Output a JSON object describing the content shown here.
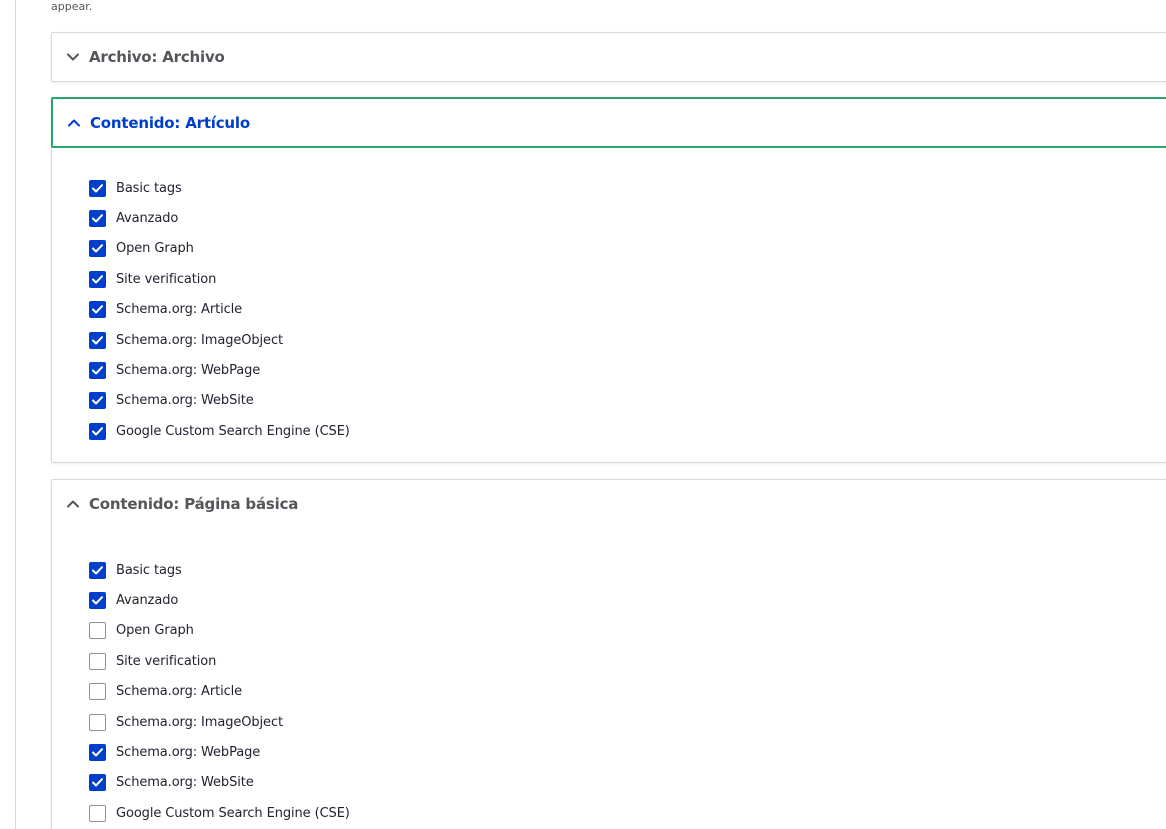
{
  "top_note": "appear.",
  "colors": {
    "accent": "#003ecc",
    "focus_border": "#26a769",
    "muted_text": "#55565b"
  },
  "panels": [
    {
      "title": "Archivo: Archivo",
      "expanded": false,
      "options": []
    },
    {
      "title": "Contenido: Artículo",
      "expanded": true,
      "focused": true,
      "options": [
        {
          "label": "Basic tags",
          "checked": true
        },
        {
          "label": "Avanzado",
          "checked": true
        },
        {
          "label": "Open Graph",
          "checked": true
        },
        {
          "label": "Site verification",
          "checked": true
        },
        {
          "label": "Schema.org: Article",
          "checked": true
        },
        {
          "label": "Schema.org: ImageObject",
          "checked": true
        },
        {
          "label": "Schema.org: WebPage",
          "checked": true
        },
        {
          "label": "Schema.org: WebSite",
          "checked": true
        },
        {
          "label": "Google Custom Search Engine (CSE)",
          "checked": true
        }
      ]
    },
    {
      "title": "Contenido: Página básica",
      "expanded": true,
      "options": [
        {
          "label": "Basic tags",
          "checked": true
        },
        {
          "label": "Avanzado",
          "checked": true
        },
        {
          "label": "Open Graph",
          "checked": false
        },
        {
          "label": "Site verification",
          "checked": false
        },
        {
          "label": "Schema.org: Article",
          "checked": false
        },
        {
          "label": "Schema.org: ImageObject",
          "checked": false
        },
        {
          "label": "Schema.org: WebPage",
          "checked": true
        },
        {
          "label": "Schema.org: WebSite",
          "checked": true
        },
        {
          "label": "Google Custom Search Engine (CSE)",
          "checked": false
        }
      ]
    }
  ]
}
